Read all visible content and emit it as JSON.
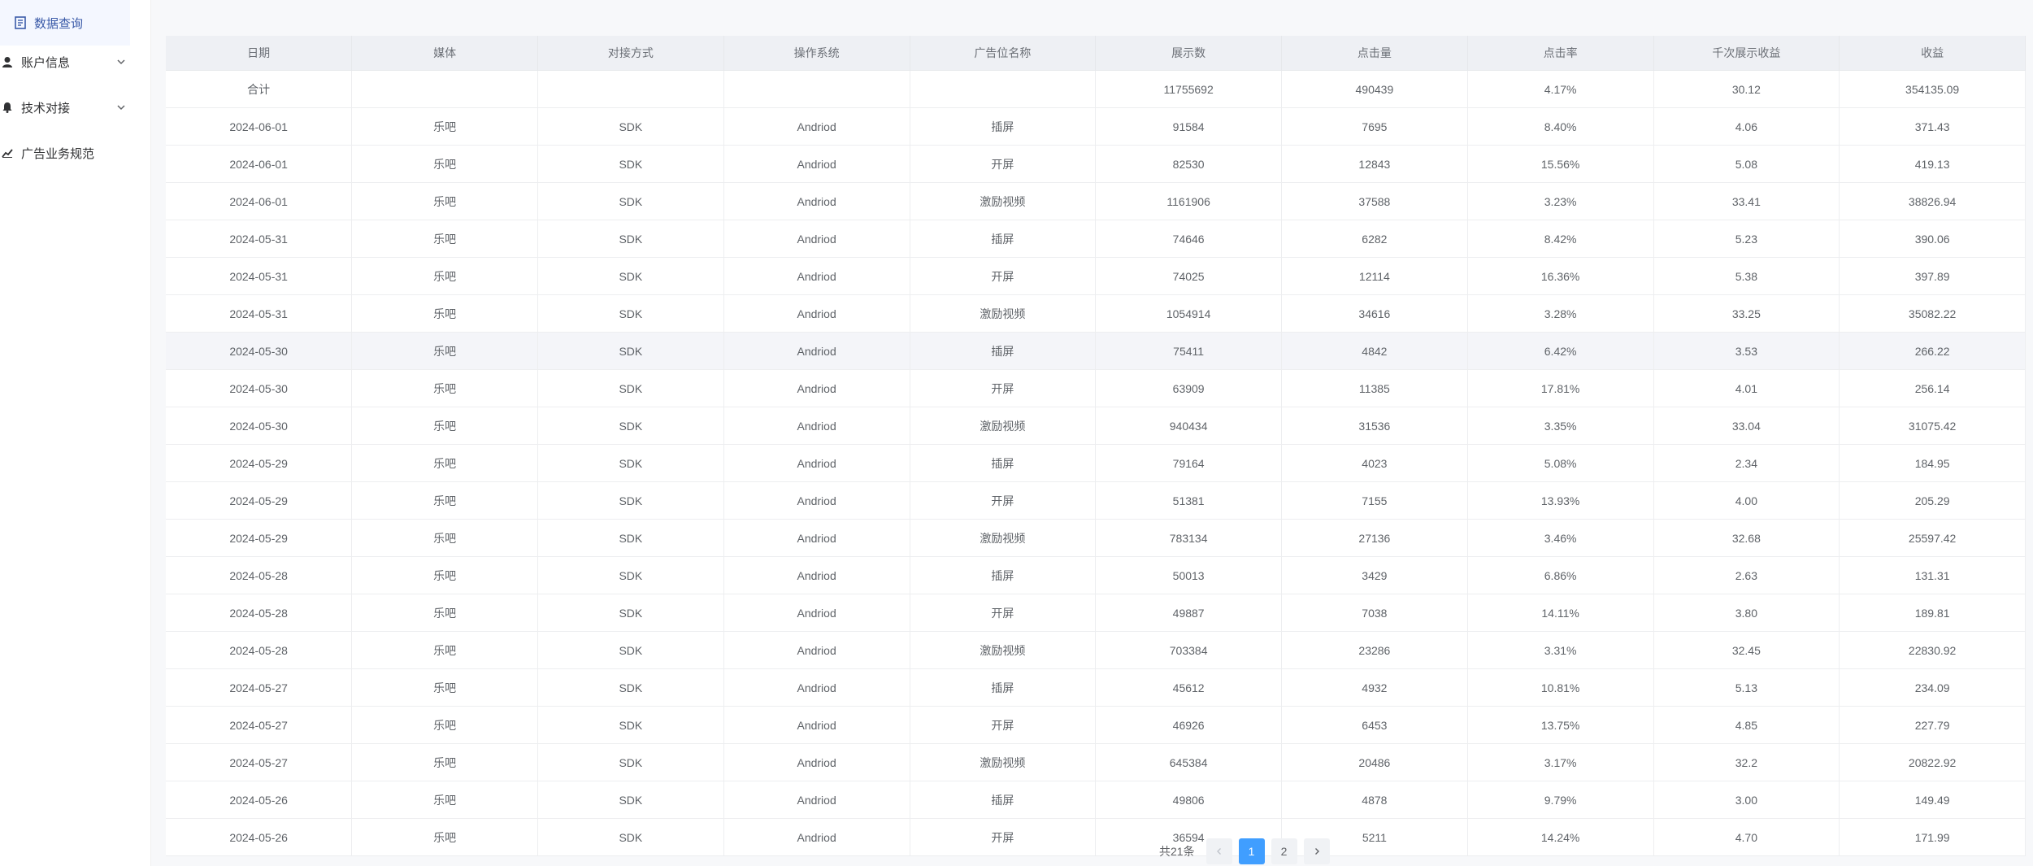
{
  "sidebar": {
    "items": [
      {
        "label": "数据查询",
        "icon": "document-icon",
        "active": true,
        "expandable": false
      },
      {
        "label": "账户信息",
        "icon": "user-icon",
        "active": false,
        "expandable": true
      },
      {
        "label": "技术对接",
        "icon": "bell-icon",
        "active": false,
        "expandable": true
      },
      {
        "label": "广告业务规范",
        "icon": "chart-icon",
        "active": false,
        "expandable": false
      }
    ]
  },
  "table": {
    "columns": [
      "日期",
      "媒体",
      "对接方式",
      "操作系统",
      "广告位名称",
      "展示数",
      "点击量",
      "点击率",
      "千次展示收益",
      "收益"
    ],
    "total_row": [
      "合计",
      "",
      "",
      "",
      "",
      "11755692",
      "490439",
      "4.17%",
      "30.12",
      "354135.09"
    ],
    "rows": [
      [
        "2024-06-01",
        "乐吧",
        "SDK",
        "Andriod",
        "插屏",
        "91584",
        "7695",
        "8.40%",
        "4.06",
        "371.43"
      ],
      [
        "2024-06-01",
        "乐吧",
        "SDK",
        "Andriod",
        "开屏",
        "82530",
        "12843",
        "15.56%",
        "5.08",
        "419.13"
      ],
      [
        "2024-06-01",
        "乐吧",
        "SDK",
        "Andriod",
        "激励视频",
        "1161906",
        "37588",
        "3.23%",
        "33.41",
        "38826.94"
      ],
      [
        "2024-05-31",
        "乐吧",
        "SDK",
        "Andriod",
        "插屏",
        "74646",
        "6282",
        "8.42%",
        "5.23",
        "390.06"
      ],
      [
        "2024-05-31",
        "乐吧",
        "SDK",
        "Andriod",
        "开屏",
        "74025",
        "12114",
        "16.36%",
        "5.38",
        "397.89"
      ],
      [
        "2024-05-31",
        "乐吧",
        "SDK",
        "Andriod",
        "激励视频",
        "1054914",
        "34616",
        "3.28%",
        "33.25",
        "35082.22"
      ],
      [
        "2024-05-30",
        "乐吧",
        "SDK",
        "Andriod",
        "插屏",
        "75411",
        "4842",
        "6.42%",
        "3.53",
        "266.22"
      ],
      [
        "2024-05-30",
        "乐吧",
        "SDK",
        "Andriod",
        "开屏",
        "63909",
        "11385",
        "17.81%",
        "4.01",
        "256.14"
      ],
      [
        "2024-05-30",
        "乐吧",
        "SDK",
        "Andriod",
        "激励视频",
        "940434",
        "31536",
        "3.35%",
        "33.04",
        "31075.42"
      ],
      [
        "2024-05-29",
        "乐吧",
        "SDK",
        "Andriod",
        "插屏",
        "79164",
        "4023",
        "5.08%",
        "2.34",
        "184.95"
      ],
      [
        "2024-05-29",
        "乐吧",
        "SDK",
        "Andriod",
        "开屏",
        "51381",
        "7155",
        "13.93%",
        "4.00",
        "205.29"
      ],
      [
        "2024-05-29",
        "乐吧",
        "SDK",
        "Andriod",
        "激励视频",
        "783134",
        "27136",
        "3.46%",
        "32.68",
        "25597.42"
      ],
      [
        "2024-05-28",
        "乐吧",
        "SDK",
        "Andriod",
        "插屏",
        "50013",
        "3429",
        "6.86%",
        "2.63",
        "131.31"
      ],
      [
        "2024-05-28",
        "乐吧",
        "SDK",
        "Andriod",
        "开屏",
        "49887",
        "7038",
        "14.11%",
        "3.80",
        "189.81"
      ],
      [
        "2024-05-28",
        "乐吧",
        "SDK",
        "Andriod",
        "激励视频",
        "703384",
        "23286",
        "3.31%",
        "32.45",
        "22830.92"
      ],
      [
        "2024-05-27",
        "乐吧",
        "SDK",
        "Andriod",
        "插屏",
        "45612",
        "4932",
        "10.81%",
        "5.13",
        "234.09"
      ],
      [
        "2024-05-27",
        "乐吧",
        "SDK",
        "Andriod",
        "开屏",
        "46926",
        "6453",
        "13.75%",
        "4.85",
        "227.79"
      ],
      [
        "2024-05-27",
        "乐吧",
        "SDK",
        "Andriod",
        "激励视频",
        "645384",
        "20486",
        "3.17%",
        "32.2",
        "20822.92"
      ],
      [
        "2024-05-26",
        "乐吧",
        "SDK",
        "Andriod",
        "插屏",
        "49806",
        "4878",
        "9.79%",
        "3.00",
        "149.49"
      ],
      [
        "2024-05-26",
        "乐吧",
        "SDK",
        "Andriod",
        "开屏",
        "36594",
        "5211",
        "14.24%",
        "4.70",
        "171.99"
      ]
    ],
    "highlighted_row": 6
  },
  "pagination": {
    "total_label": "共21条",
    "pages": [
      "1",
      "2"
    ],
    "current": "1",
    "prev_icon": "chevron-left-icon",
    "next_icon": "chevron-right-icon"
  },
  "colors": {
    "accent": "#409eff",
    "active_menu_bg": "#f4f7ff",
    "active_menu_text": "#3a5aa8",
    "header_bg": "#eef0f4"
  }
}
